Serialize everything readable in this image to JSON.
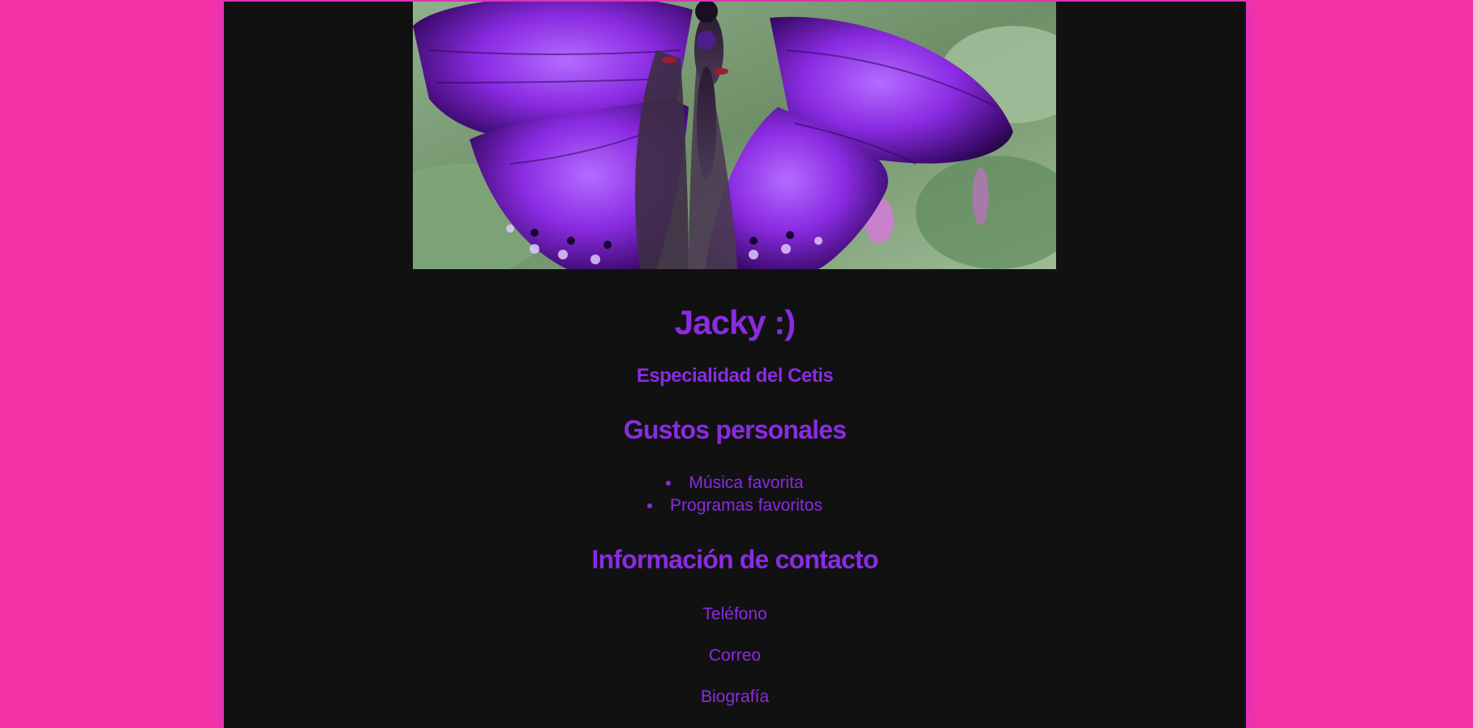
{
  "colors": {
    "background": "#f332a8",
    "panel": "#111111",
    "text": "#8a2be2"
  },
  "hero": {
    "image": "purple-butterfly-photo"
  },
  "profile": {
    "name": "Jacky :)",
    "specialty": "Especialidad del Cetis"
  },
  "likes": {
    "heading": "Gustos personales",
    "items": [
      "Música favorita",
      "Programas favoritos"
    ]
  },
  "contact": {
    "heading": "Información de contacto",
    "links": [
      "Teléfono",
      "Correo",
      "Biografía"
    ]
  }
}
